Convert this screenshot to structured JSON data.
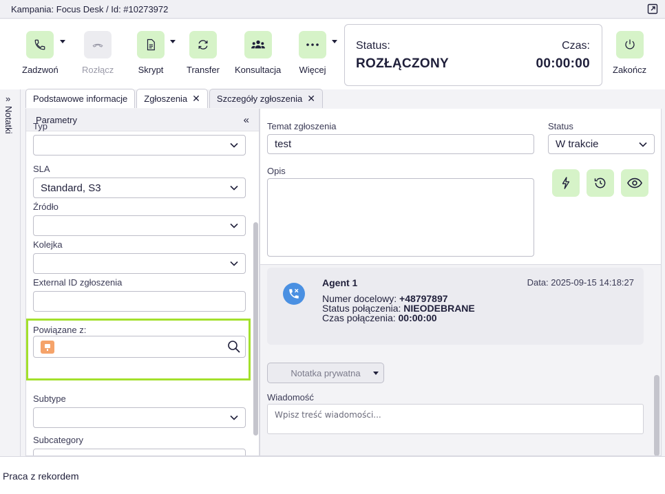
{
  "header": {
    "title": "Kampania: Focus Desk / Id: #10273972"
  },
  "toolbar": {
    "call": "Zadzwoń",
    "hangup": "Rozłącz",
    "script": "Skrypt",
    "transfer": "Transfer",
    "consult": "Konsultacja",
    "more": "Więcej",
    "end": "Zakończ"
  },
  "status": {
    "status_label": "Status:",
    "status_value": "ROZŁĄCZONY",
    "time_label": "Czas:",
    "time_value": "00:00:00"
  },
  "side": {
    "notes": "Notatki"
  },
  "tabs": [
    {
      "label": "Podstawowe informacje"
    },
    {
      "label": "Zgłoszenia"
    },
    {
      "label": "Szczegóły zgłoszenia"
    }
  ],
  "params": {
    "title": "Parametry",
    "type_label": "Typ",
    "type_value": "",
    "sla_label": "SLA",
    "sla_value": "Standard, S3",
    "source_label": "Źródło",
    "source_value": "",
    "queue_label": "Kolejka",
    "queue_value": "",
    "external_id_label": "External ID zgłoszenia",
    "linked_label": "Powiązane z:",
    "subtype_label": "Subtype",
    "subtype_value": "",
    "subcategory_label": "Subcategory"
  },
  "ticket": {
    "subject_label": "Temat zgłoszenia",
    "subject_value": "test",
    "status_label": "Status",
    "status_value": "W trakcie",
    "description_label": "Opis"
  },
  "history": {
    "agent": "Agent 1",
    "date": "Data: 2025-09-15 14:18:27",
    "number_label": "Numer docelowy:",
    "number_value": "+48797897",
    "conn_status_label": "Status połączenia:",
    "conn_status_value": "NIEODEBRANE",
    "conn_time_label": "Czas połączenia:",
    "conn_time_value": "00:00:00"
  },
  "compose": {
    "note_type": "Notatka prywatna",
    "message_label": "Wiadomość",
    "message_placeholder": "Wpisz treść wiadomości..."
  },
  "footer": {
    "label": "Praca z rekordem"
  }
}
